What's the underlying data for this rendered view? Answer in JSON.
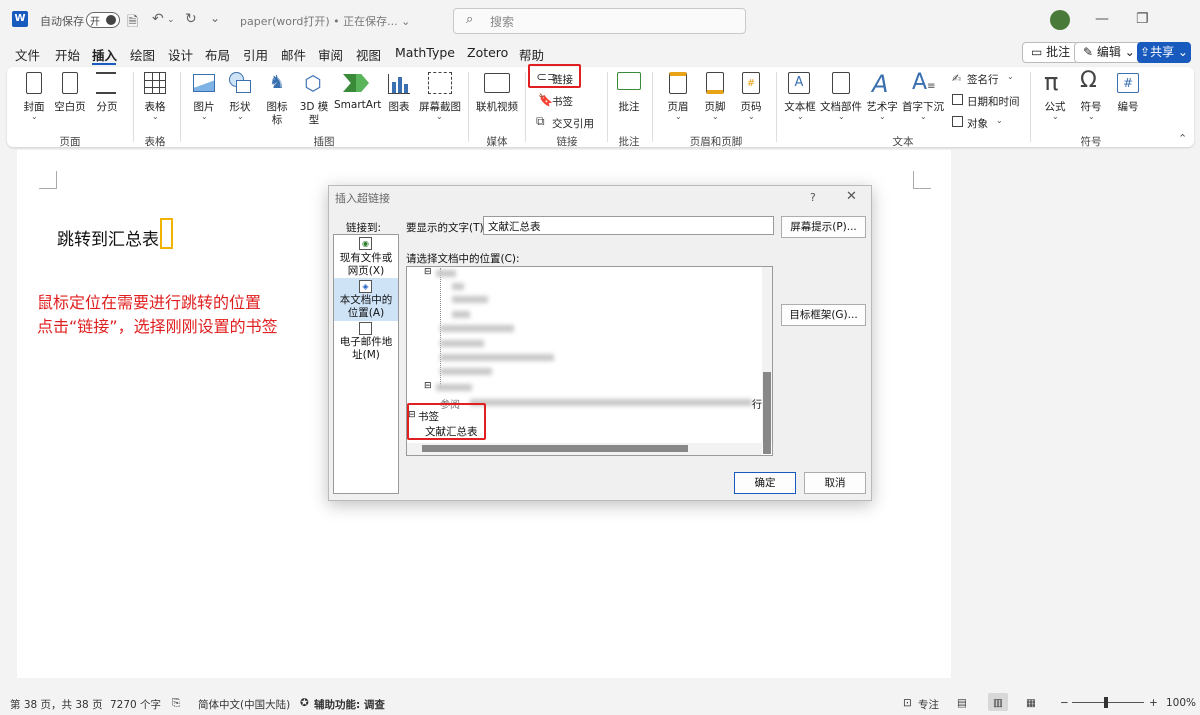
{
  "titlebar": {
    "app_logo": "W",
    "autosave_label": "自动保存",
    "autosave_state": "开",
    "doc_title": "paper(word打开) • 正在保存... ⌄",
    "search_placeholder": "搜索",
    "icons": [
      "save-icon",
      "undo-icon",
      "redo-icon",
      "dropdown-icon"
    ],
    "minimize": "—",
    "restore": "❐"
  },
  "menu": {
    "tabs": [
      "文件",
      "开始",
      "插入",
      "绘图",
      "设计",
      "布局",
      "引用",
      "邮件",
      "审阅",
      "视图",
      "MathType",
      "Zotero",
      "帮助"
    ],
    "active": "插入",
    "comment_btn": "批注",
    "edit_btn": "编辑 ⌄",
    "share_btn": "共享 ⌄"
  },
  "ribbon": {
    "pages": {
      "cover": "封面",
      "blank": "空白页",
      "break": "分页",
      "group": "页面"
    },
    "tables": {
      "table": "表格",
      "group": "表格"
    },
    "illustrations": {
      "picture": "图片",
      "shapes": "形状",
      "icons": "图标",
      "icons2": "标",
      "model": "3D 模",
      "model2": "型",
      "smartart": "SmartArt",
      "chart": "图表",
      "screenshot": "屏幕截图",
      "group": "插图"
    },
    "media": {
      "video": "联机视频",
      "group": "媒体"
    },
    "links": {
      "link": "链接",
      "bookmark": "书签",
      "crossref": "交叉引用",
      "group": "链接"
    },
    "comments": {
      "comment": "批注",
      "group": "批注"
    },
    "header_footer": {
      "header": "页眉",
      "footer": "页脚",
      "page_number": "页码",
      "group": "页眉和页脚"
    },
    "text": {
      "textbox": "文本框",
      "quickparts": "文档部件",
      "wordart": "艺术字",
      "dropcap": "首字下沉",
      "signature": "签名行",
      "datetime": "日期和时间",
      "object": "对象",
      "group": "文本"
    },
    "symbols": {
      "equation": "公式",
      "symbol": "符号",
      "numbering": "编号",
      "group": "符号"
    }
  },
  "document": {
    "line_text": "跳转到汇总表",
    "note_line1": "鼠标定位在需要进行跳转的位置",
    "note_line2": "点击“链接”，选择刚刚设置的书签"
  },
  "dialog": {
    "title": "插入超链接",
    "help": "?",
    "close": "✕",
    "link_to_label": "链接到:",
    "display_text_label": "要显示的文字(T):",
    "display_text_value": "文献汇总表",
    "screentip_btn": "屏幕提示(P)...",
    "select_place_label": "请选择文档中的位置(C):",
    "target_frame_btn": "目标框架(G)...",
    "nav": {
      "existing": "现有文件或网页(X)",
      "this_doc": "本文档中的位置(A)",
      "email": "电子邮件地址(M)"
    },
    "tree_bookmarks_label": "书签",
    "tree_bookmark_item": "文献汇总表",
    "tree_partial": "参阅",
    "tree_trailing": "行",
    "ok_btn": "确定",
    "cancel_btn": "取消"
  },
  "status": {
    "page": "第 38 页，共 38 页",
    "words": "7270 个字",
    "language": "简体中文(中国大陆)",
    "accessibility": "辅助功能: 调查",
    "focus": "专注",
    "zoom": "100%",
    "zoom_level": 1.0
  }
}
